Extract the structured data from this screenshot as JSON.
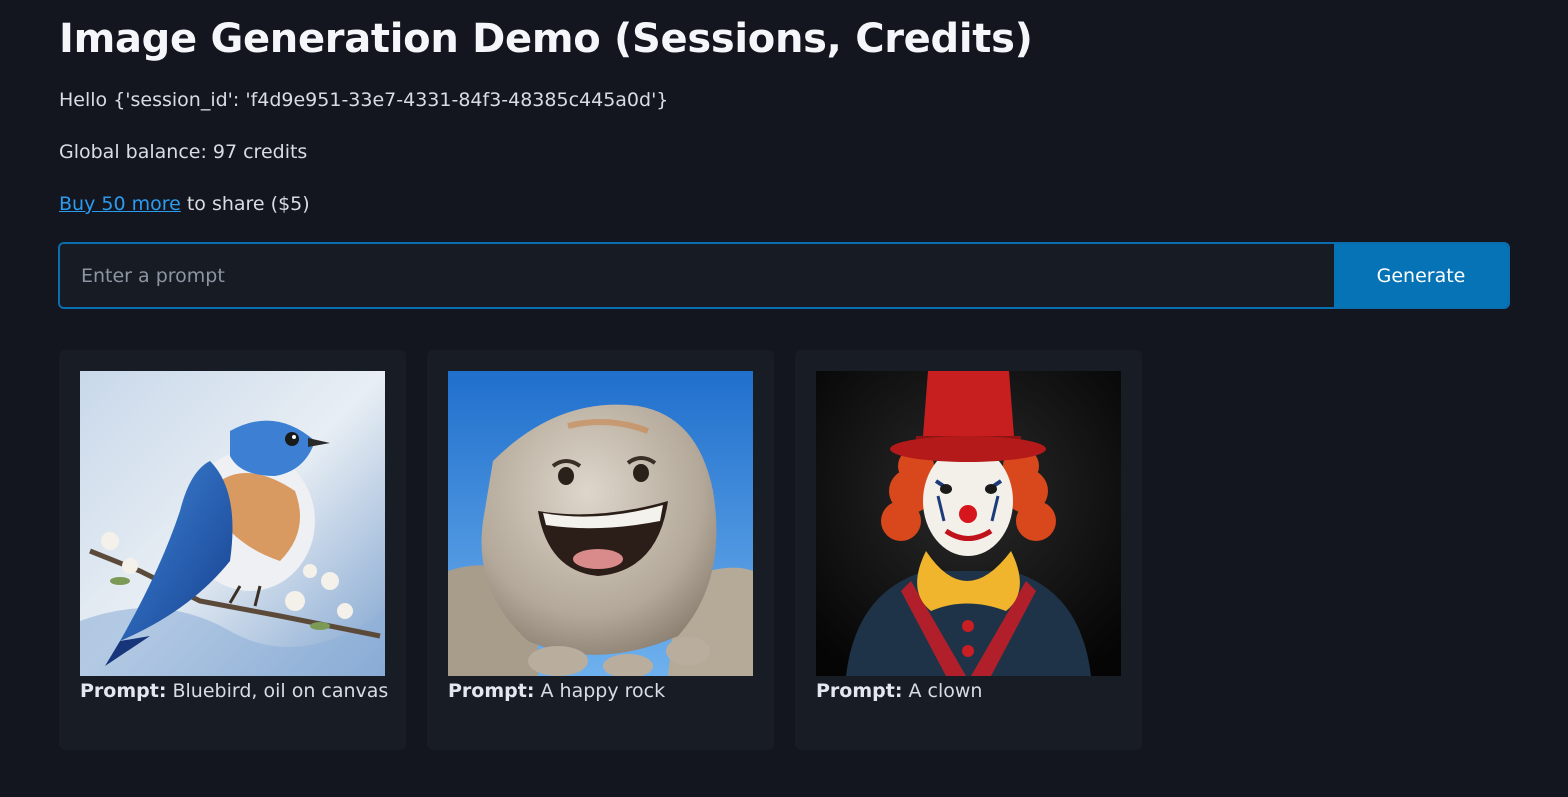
{
  "header": {
    "title": "Image Generation Demo (Sessions, Credits)"
  },
  "session": {
    "hello_text": "Hello {'session_id': 'f4d9e951-33e7-4331-84f3-48385c445a0d'}"
  },
  "balance": {
    "text": "Global balance: 97 credits"
  },
  "purchase": {
    "link_label": "Buy 50 more",
    "suffix": " to share ($5)"
  },
  "prompt": {
    "placeholder": "Enter a prompt",
    "value": "",
    "button_label": "Generate"
  },
  "gallery": {
    "caption_prefix": "Prompt:",
    "items": [
      {
        "prompt": "Bluebird, oil on canvas",
        "image": "bluebird-painting"
      },
      {
        "prompt": "A happy rock",
        "image": "smiling-rock"
      },
      {
        "prompt": "A clown",
        "image": "clown-portrait"
      }
    ]
  },
  "colors": {
    "background": "#13161e",
    "card": "#181c25",
    "accent": "#0673b6",
    "link": "#2b9bf0"
  }
}
